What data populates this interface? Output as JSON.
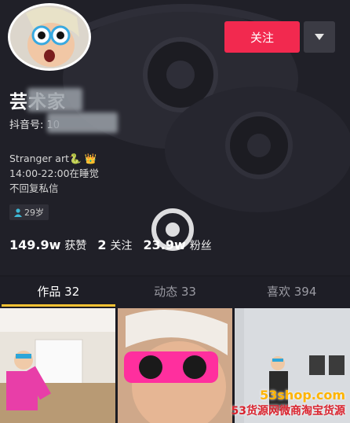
{
  "header": {
    "follow_label": "关注",
    "accent_color": "#f2294f"
  },
  "profile": {
    "name": "芸术家",
    "douyin_id_label": "抖音号: 10",
    "bio_lines": [
      "Stranger art🐍 👑",
      "14:00-22:00在睡觉",
      "不回复私信"
    ],
    "age_tag": "29岁"
  },
  "stats": {
    "likes_value": "149.9w",
    "likes_label": "获赞",
    "following_value": "2",
    "following_label": "关注",
    "followers_value": "23.9w",
    "followers_label": "粉丝"
  },
  "tabs": [
    {
      "label": "作品 32",
      "active": true
    },
    {
      "label": "动态 33",
      "active": false
    },
    {
      "label": "喜欢 394",
      "active": false
    }
  ],
  "watermark": {
    "top": "53shop.com",
    "bottom": "53货源网微商淘宝货源"
  }
}
